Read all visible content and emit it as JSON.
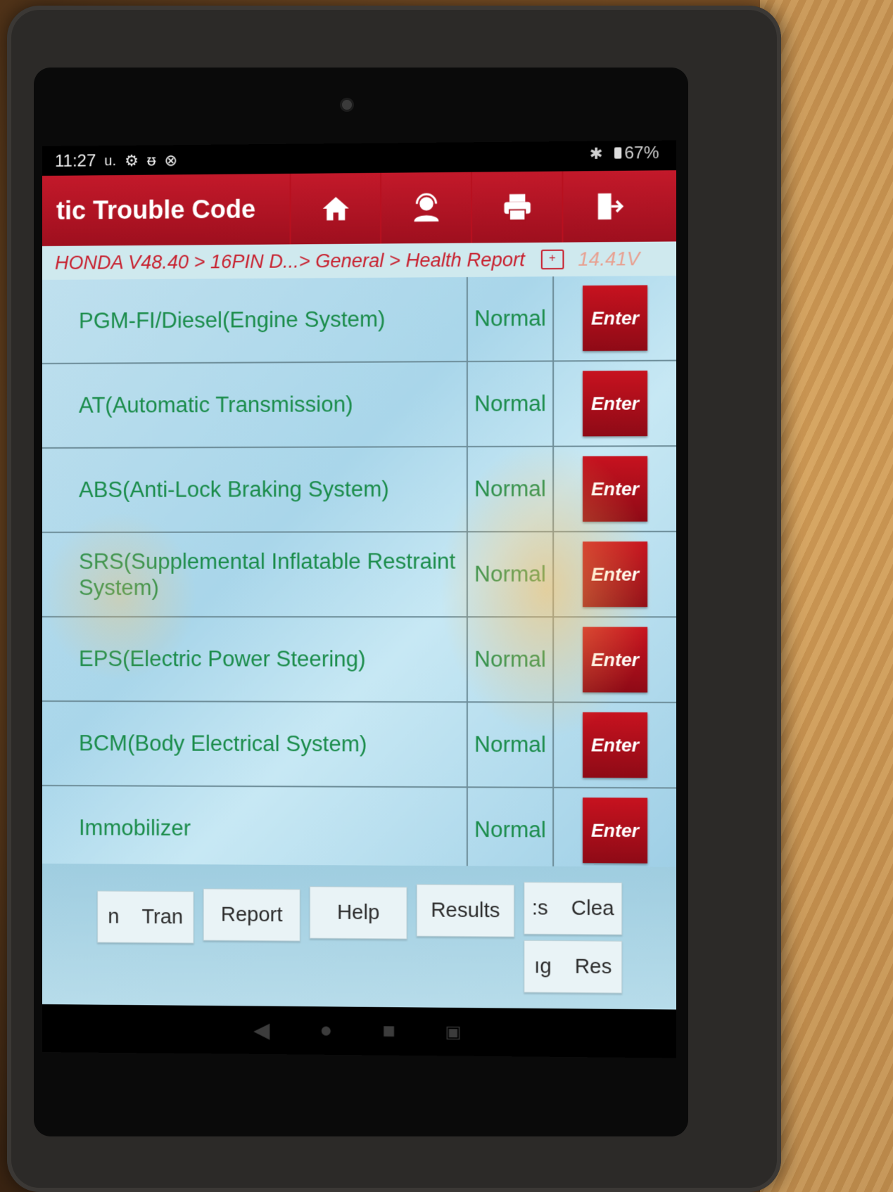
{
  "status_bar": {
    "time": "11:27",
    "suffix": "u.",
    "battery": "67%"
  },
  "title_bar": {
    "title": "tic Trouble Code",
    "icons": [
      "home-icon",
      "support-agent-icon",
      "printer-icon",
      "exit-icon"
    ]
  },
  "breadcrumb": {
    "path": "HONDA V48.40 > 16PIN D...> General > Health Report",
    "voltage": "14.41V"
  },
  "systems": [
    {
      "name": "PGM-FI/Diesel(Engine System)",
      "status": "Normal",
      "action": "Enter"
    },
    {
      "name": "AT(Automatic Transmission)",
      "status": "Normal",
      "action": "Enter"
    },
    {
      "name": "ABS(Anti-Lock Braking System)",
      "status": "Normal",
      "action": "Enter"
    },
    {
      "name": "SRS(Supplemental Inflatable Restraint System)",
      "status": "Normal",
      "action": "Enter"
    },
    {
      "name": "EPS(Electric Power Steering)",
      "status": "Normal",
      "action": "Enter"
    },
    {
      "name": "BCM(Body Electrical System)",
      "status": "Normal",
      "action": "Enter"
    },
    {
      "name": "Immobilizer",
      "status": "Normal",
      "action": "Enter"
    }
  ],
  "toolbar": {
    "tran": "n    Tran",
    "report": "Report",
    "help": "Help",
    "results": "Results",
    "clear": ":s    Clea",
    "reset": "ıg    Res"
  },
  "colors": {
    "header_red": "#c3192a",
    "system_green": "#1a8c4a",
    "breadcrumb_red": "#c8202e",
    "list_bg": "#bfe0ee"
  }
}
